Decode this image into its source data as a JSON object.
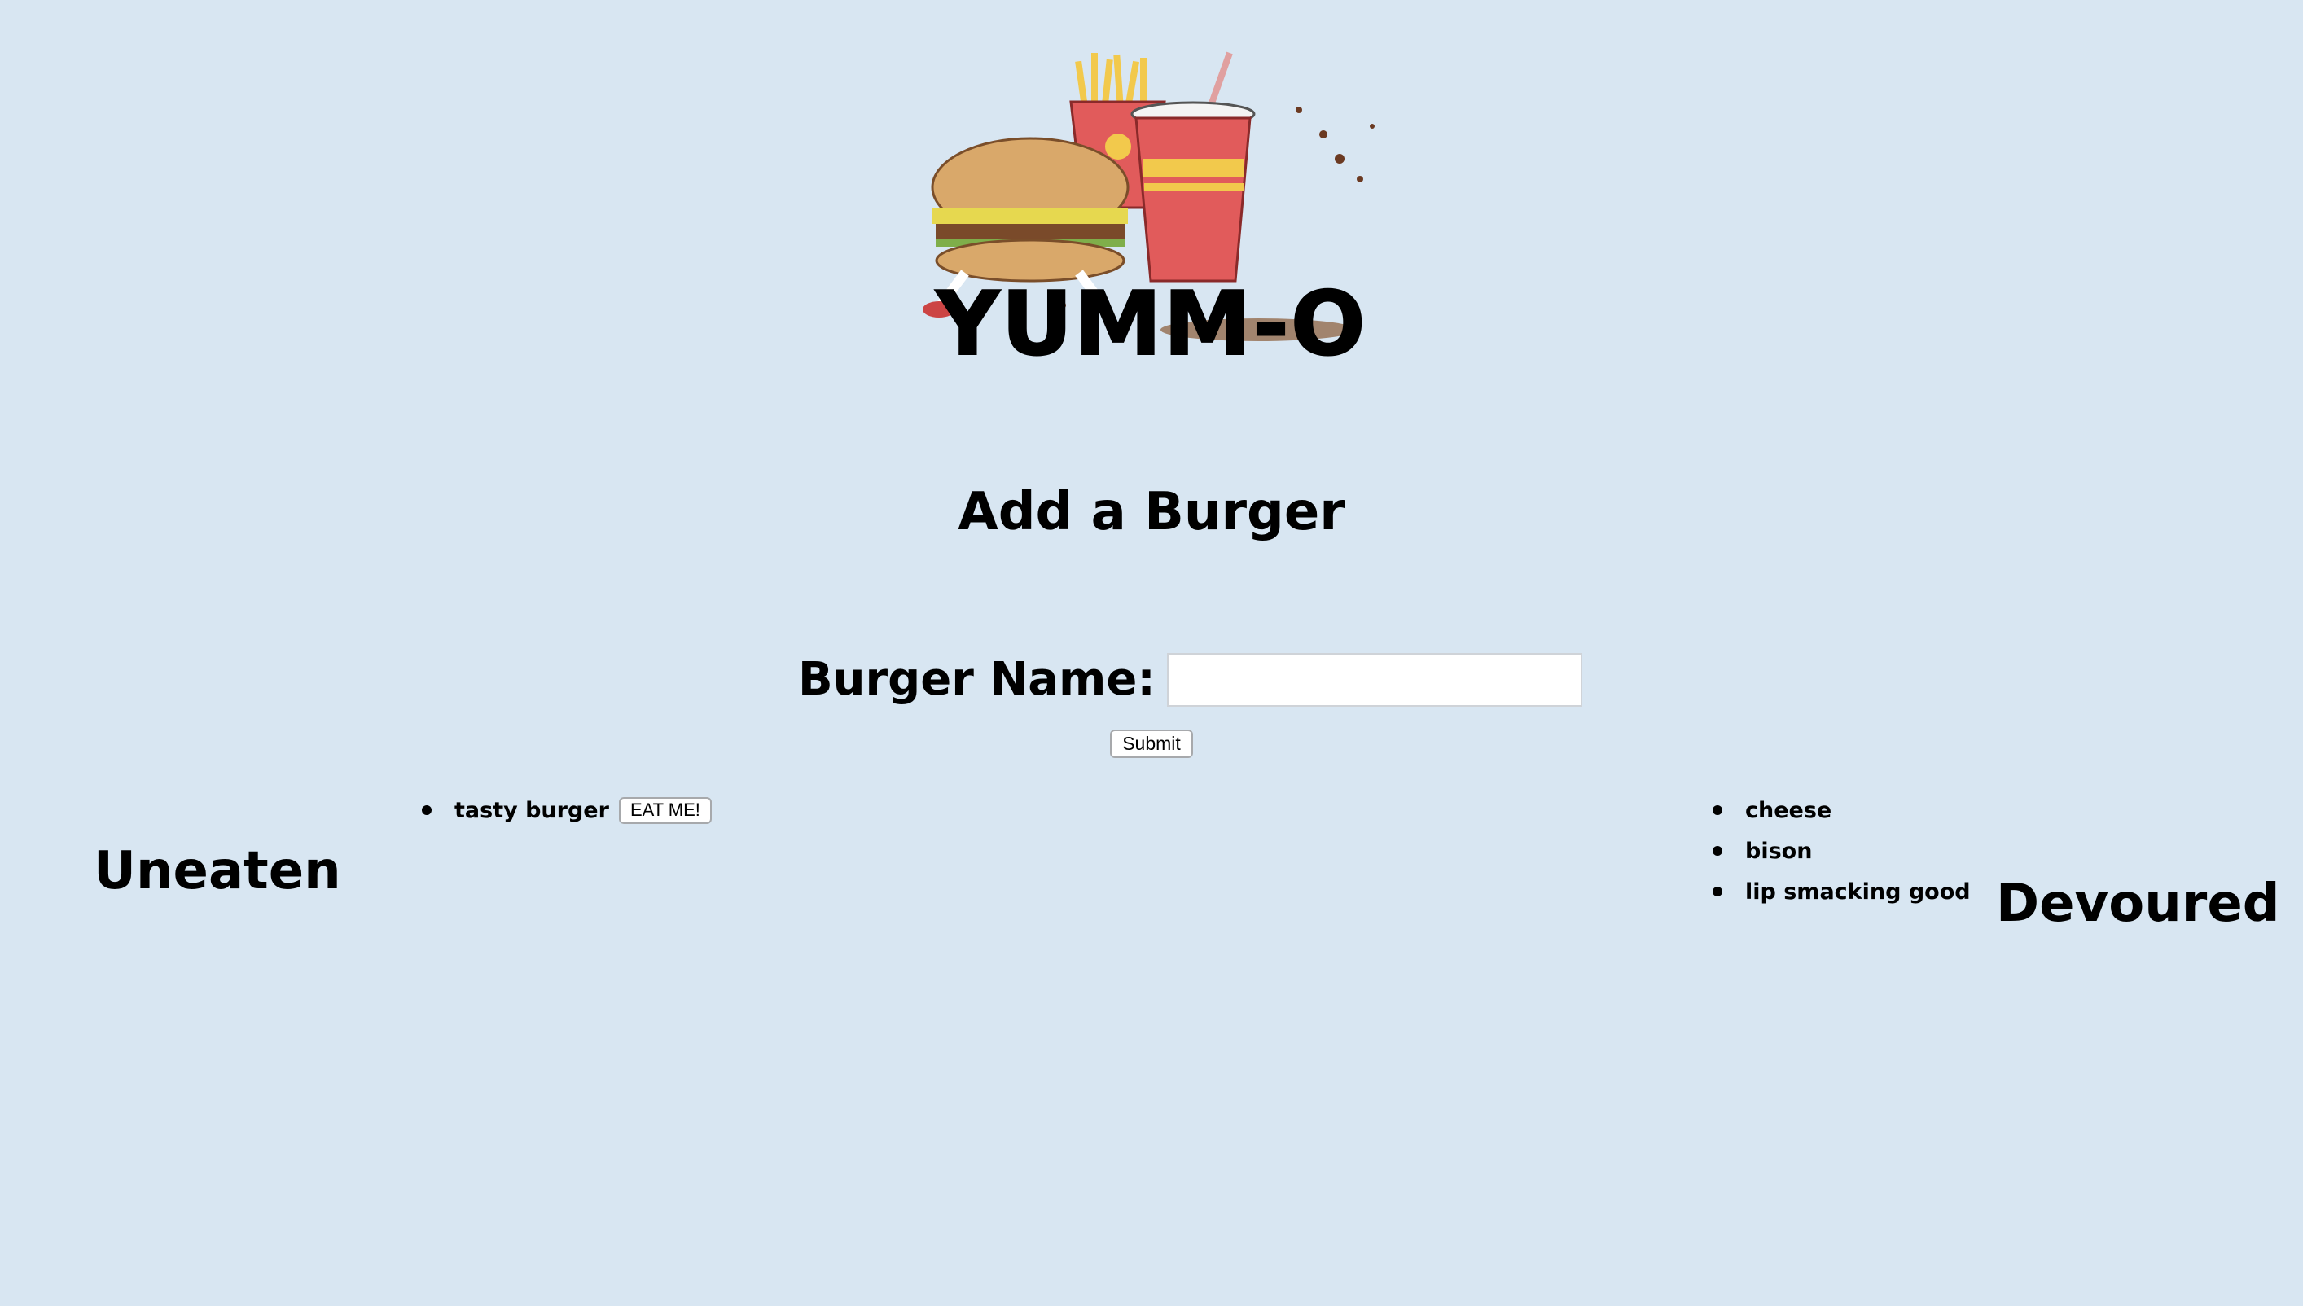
{
  "header": {
    "logo_title": "YUMM-O"
  },
  "form": {
    "section_title": "Add a Burger",
    "name_label": "Burger Name:",
    "name_value": "",
    "name_placeholder": "",
    "submit_label": "Submit"
  },
  "uneaten": {
    "heading": "Uneaten",
    "items": [
      {
        "name": "tasty burger",
        "button_label": "EAT ME!"
      }
    ]
  },
  "devoured": {
    "heading": "Devoured",
    "items": [
      {
        "name": "cheese"
      },
      {
        "name": "bison"
      },
      {
        "name": "lip smacking good"
      }
    ]
  },
  "colors": {
    "page_background": "#d8e6f2",
    "text": "#000000"
  }
}
